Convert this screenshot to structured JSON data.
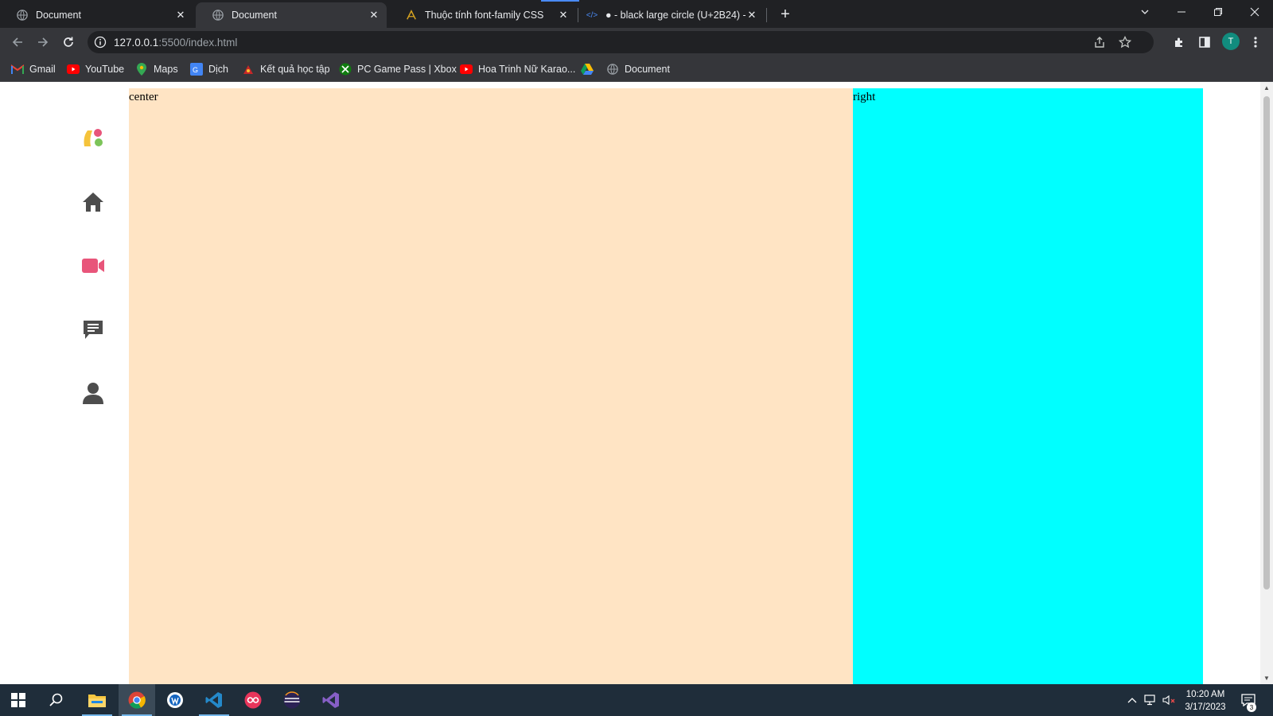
{
  "browser": {
    "tabs": [
      {
        "title": "Document",
        "icon": "globe-icon",
        "active": false
      },
      {
        "title": "Document",
        "icon": "globe-icon",
        "active": true
      },
      {
        "title": "Thuộc tính font-family CSS",
        "icon": "site-icon",
        "active": false
      },
      {
        "title": "● - black large circle (U+2B24) - ",
        "icon": "code-icon",
        "active": false
      }
    ],
    "new_tab_label": "+",
    "address": {
      "host": "127.0.0.1",
      "rest": ":5500/index.html"
    },
    "profile_initial": "T"
  },
  "bookmarks": [
    {
      "label": "Gmail",
      "icon": "gmail-icon"
    },
    {
      "label": "YouTube",
      "icon": "youtube-icon"
    },
    {
      "label": "Maps",
      "icon": "maps-icon"
    },
    {
      "label": "Dịch",
      "icon": "translate-icon"
    },
    {
      "label": "Kết quả học tập",
      "icon": "school-icon"
    },
    {
      "label": "PC Game Pass | Xbox",
      "icon": "xbox-icon"
    },
    {
      "label": "Hoa Trinh Nữ Karao...",
      "icon": "youtube-icon"
    },
    {
      "label": "",
      "icon": "drive-icon"
    },
    {
      "label": "Document",
      "icon": "globe-icon"
    }
  ],
  "page": {
    "sidebar_icons": [
      "logo-icon",
      "home-icon",
      "video-icon",
      "chat-icon",
      "user-icon"
    ],
    "center_text": "center",
    "right_text": "right",
    "colors": {
      "center": "#ffe4c4",
      "right": "#00ffff",
      "video": "#e8557a",
      "icons": "#4d4d4d"
    }
  },
  "taskbar": {
    "apps": [
      "start-icon",
      "search-icon",
      "file-explorer-icon",
      "chrome-icon",
      "app-icon",
      "vscode-icon",
      "app-icon",
      "eclipse-icon",
      "visual-studio-icon"
    ],
    "time": "10:20 AM",
    "date": "3/17/2023",
    "notification_count": "3"
  }
}
